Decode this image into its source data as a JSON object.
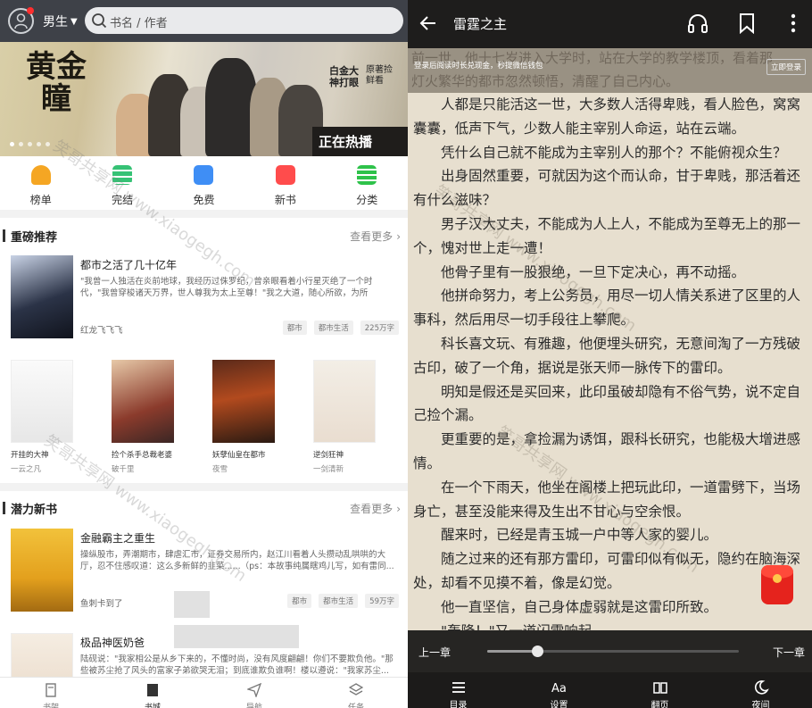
{
  "left": {
    "topbar": {
      "gender": "男生",
      "search_placeholder": "书名 / 作者"
    },
    "banner": {
      "title": "黄金瞳",
      "promo_main": "白金大神打眼",
      "promo_sub": "原著捡鲜看",
      "status": "正在热播"
    },
    "categories": [
      {
        "label": "榜单",
        "color": "#f5a623"
      },
      {
        "label": "完结",
        "color": "#36c275"
      },
      {
        "label": "免费",
        "color": "#3f8ef5"
      },
      {
        "label": "新书",
        "color": "#ff4c4c"
      },
      {
        "label": "分类",
        "color": "#2ec24a"
      }
    ],
    "section1": {
      "title": "重磅推荐",
      "more": "查看更多",
      "feature": {
        "title": "都市之活了几十亿年",
        "desc": "\"我曾一人独活在炎前地球，我经历过侏罗纪，曾亲眼看着小行星灭绝了一个时代，\"我曾穿梭诸天万界，世人尊我为太上至尊！\"我之大道，随心所欲，为所",
        "author": "红龙飞飞飞",
        "tags": [
          "都市",
          "都市生活",
          "225万字"
        ]
      },
      "grid": [
        {
          "name": "开挂的大神",
          "author": "一云之凡"
        },
        {
          "name": "捡个杀手总裁老婆",
          "author": "破千里"
        },
        {
          "name": "妖孽仙皇在都市",
          "author": "夜雪"
        },
        {
          "name": "逆剑狂神",
          "author": "一剑清新"
        }
      ]
    },
    "section2": {
      "title": "潜力新书",
      "more": "查看更多",
      "feature1": {
        "title": "金融霸主之重生",
        "desc": "操纵股市，弄潮期市，肆虐汇市，证券交易所内，赵江川看着人头攒动乱哄哄的大厅，忍不住感叹道：这么多新鲜的韭菜......（ps：本故事纯属瞎鸡儿写，如有雷同...",
        "author": "鱼刺卡到了",
        "tags": [
          "都市",
          "都市生活",
          "59万字"
        ]
      },
      "feature2": {
        "title": "极品神医奶爸",
        "desc": "陆砚说：\"我家相公是从乡下来的，不懂时尚，没有风度翩翩！你们不要欺负他。\"那些被苏尘抢了风头的富家子弟欲哭无泪；到底谁欺负谁啊！楼以遵说：\"我家苏尘..."
      }
    },
    "tabbar": [
      {
        "label": "书架",
        "icon": "bookshelf-icon",
        "active": false
      },
      {
        "label": "书城",
        "icon": "bookstore-icon",
        "active": true
      },
      {
        "label": "导航",
        "icon": "navigation-icon",
        "active": false
      },
      {
        "label": "任务",
        "icon": "tasks-icon",
        "active": false
      }
    ],
    "watermark": "笑哥共享网 www.xiaogegh.com"
  },
  "right": {
    "title": "雷霆之主",
    "ghost_top1": "前一世，他十七岁进入大学时，站在大学的教学楼顶，看着那",
    "ghost_top2": "灯火繁华的都市忽然顿悟，清醒了自己内心。",
    "login_prompt": "登录后阅读时长兑现金，秒提微信钱包",
    "login_button": "立即登录",
    "paragraphs": [
      "人都是只能活这一世，大多数人活得卑贱，看人脸色，窝窝囊囊，低声下气，少数人能主宰别人命运，站在云端。",
      "凭什么自己就不能成为主宰别人的那个？不能俯视众生？",
      "出身固然重要，可就因为这个而认命，甘于卑贱，那活着还有什么滋味？",
      "男子汉大丈夫，不能成为人上人，不能成为至尊无上的那一个，愧对世上走一遭！",
      "他骨子里有一股狠绝，一旦下定决心，再不动摇。",
      "他拼命努力，考上公务员，用尽一切人情关系进了区里的人事科，然后用尽一切手段往上攀爬。",
      "科长喜文玩、有雅趣，他便埋头研究，无意间淘了一方残破古印，破了一个角，据说是张天师一脉传下的雷印。",
      "明知是假还是买回来，此印虽破却隐有不俗气势，说不定自己捡个漏。",
      "更重要的是，拿捡漏为诱饵，跟科长研究，也能极大增进感情。",
      "在一个下雨天，他坐在阁楼上把玩此印，一道雷劈下，当场身亡，甚至没能来得及生出不甘心与空余恨。",
      "醒来时，已经是青玉城一户中等人家的婴儿。",
      "随之过来的还有那方雷印，可雷印似有似无，隐约在脑海深处，却看不见摸不着，像是幻觉。",
      "他一直坚信，自己身体虚弱就是这雷印所致。",
      "\"轰隆！\"又一道闪雷响起。"
    ],
    "prev": "上一章",
    "next": "下一章",
    "progress": 0.2,
    "bottom": [
      {
        "label": "目录",
        "icon": "toc-icon"
      },
      {
        "label": "设置",
        "icon": "font-settings-icon"
      },
      {
        "label": "翻页",
        "icon": "page-turn-icon"
      },
      {
        "label": "夜间",
        "icon": "night-mode-icon"
      }
    ]
  }
}
